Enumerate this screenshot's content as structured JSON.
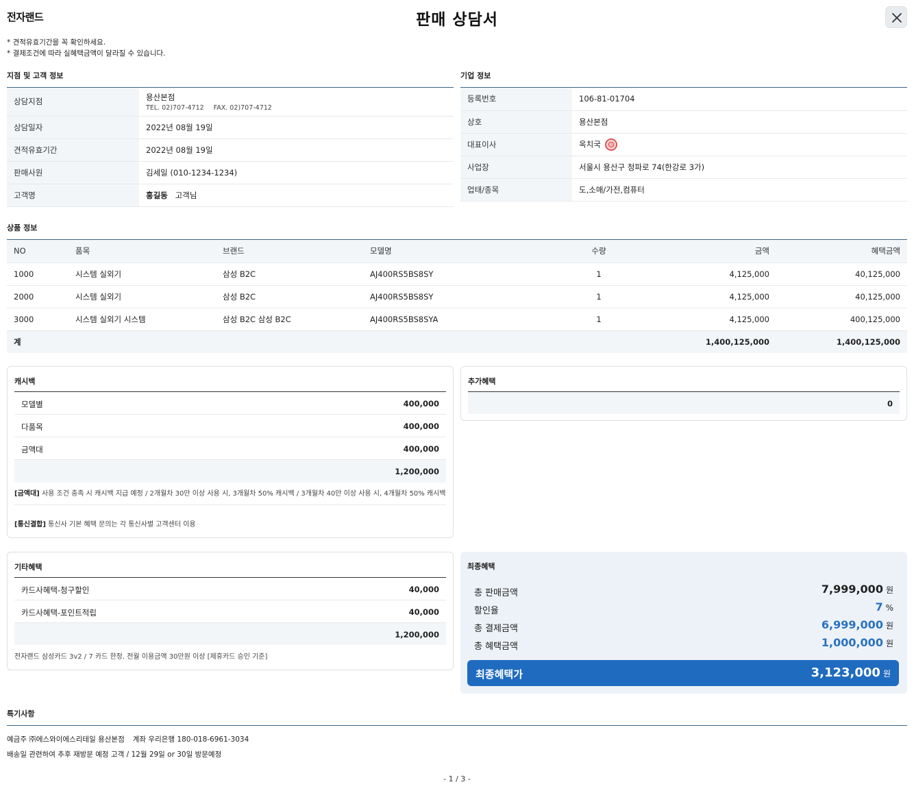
{
  "header": {
    "brand": "전자랜드",
    "title": "판매 상담서",
    "close_icon": "close-icon"
  },
  "notes": [
    "* 견적유효기간을 꼭 확인하세요.",
    "* 결제조건에 따라 실혜택금액이 달라질 수 있습니다."
  ],
  "branch": {
    "title": "지점 및 고객 정보",
    "store_label": "상담지점",
    "store_name": "용산본점",
    "tel": "TEL. 02)707-4712",
    "fax": "FAX. 02)707-4712",
    "date_label": "상담일자",
    "date_value": "2022년 08월 19일",
    "valid_label": "견적유효기간",
    "valid_value": "2022년 08월 19일",
    "seller_label": "판매사원",
    "seller_value": "김세일 (010-1234-1234)",
    "customer_label": "고객명",
    "customer_name": "홍길동",
    "customer_suffix": "고객님"
  },
  "company": {
    "title": "기업 정보",
    "reg_label": "등록번호",
    "reg_value": "106-81-01704",
    "name_label": "상호",
    "name_value": "용산본점",
    "ceo_label": "대표이사",
    "ceo_value": "옥치국",
    "addr_label": "사업장",
    "addr_value": "서울시 용산구 청파로 74(한강로 3가)",
    "biz_label": "업태/종목",
    "biz_value": "도,소매/가전,컴퓨터"
  },
  "products": {
    "title": "상품 정보",
    "headers": [
      "NO",
      "품목",
      "브랜드",
      "모델명",
      "수량",
      "금액",
      "혜택금액"
    ],
    "rows": [
      [
        "1000",
        "시스템 실외기",
        "삼성 B2C",
        "AJ400RS5BS8SY",
        "1",
        "4,125,000",
        "40,125,000"
      ],
      [
        "2000",
        "시스템 실외기",
        "삼성 B2C",
        "AJ400RS5BS8SY",
        "1",
        "4,125,000",
        "40,125,000"
      ],
      [
        "3000",
        "시스템 실외기 시스템",
        "삼성 B2C 삼성 B2C",
        "AJ400RS5BS8SYA",
        "1",
        "4,125,000",
        "400,125,000"
      ]
    ],
    "total_label": "계",
    "total_amount": "1,400,125,000",
    "total_benefit": "1,400,125,000"
  },
  "cashback": {
    "title": "캐시백",
    "items": [
      {
        "label": "모델별",
        "value": "400,000"
      },
      {
        "label": "다품목",
        "value": "400,000"
      },
      {
        "label": "금액대",
        "value": "400,000"
      }
    ],
    "total": "1,200,000",
    "note1_tag": "[금액대]",
    "note1_text": "사용 조건 충족 시 캐시백 지급 예정 / 2개월차 30만 이상 사용 시, 3개월차 50% 캐시백 / 3개월차 40만 이상 사용 시, 4개월차 50% 캐시백",
    "note2_tag": "[통신결합]",
    "note2_text": "통신사 기본 혜택 문의는 각 통신사별 고객센터 이용"
  },
  "extra": {
    "title": "추가혜택",
    "value": "0"
  },
  "other": {
    "title": "기타혜택",
    "items": [
      {
        "label": "카드사혜택-청구할인",
        "value": "40,000"
      },
      {
        "label": "카드사혜택-포인트적립",
        "value": "40,000"
      }
    ],
    "total": "1,200,000",
    "note": "전자랜드 삼성카드 3v2 / 7 카드 한정. 전월 이용금액 30만원 이상 [제휴카드 승인 기준]"
  },
  "final": {
    "title": "최종혜택",
    "sale_label": "총 판매금액",
    "sale_value": "7,999,000",
    "rate_label": "할인율",
    "rate_value": "7",
    "rate_unit": "%",
    "pay_label": "총 결제금액",
    "pay_value": "6,999,000",
    "benefit_label": "총 혜택금액",
    "benefit_value": "1,000,000",
    "won": "원",
    "final_label": "최종혜택가",
    "final_value": "3,123,000",
    "accent_color": "#1f6bbf"
  },
  "remarks": {
    "title": "특기사항",
    "line1_a": "예금주 ㈜에스와이에스리테일 용산본점",
    "line1_b": "계좌 우리은행 180-018-6961-3034",
    "line2": "배송일 관련하여 추후 재방문 예정 고객 / 12월 29일 or 30일 방문예정"
  },
  "pager": "- 1 / 3 -"
}
